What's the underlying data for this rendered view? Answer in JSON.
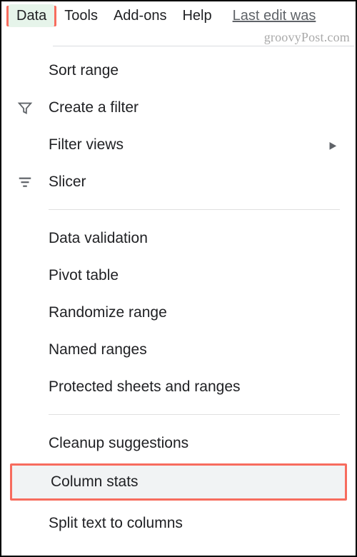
{
  "menubar": {
    "data": "Data",
    "tools": "Tools",
    "addons": "Add-ons",
    "help": "Help",
    "last_edit": "Last edit was"
  },
  "watermark": "groovyPost.com",
  "menu": {
    "sort_range": "Sort range",
    "create_filter": "Create a filter",
    "filter_views": "Filter views",
    "slicer": "Slicer",
    "data_validation": "Data validation",
    "pivot_table": "Pivot table",
    "randomize_range": "Randomize range",
    "named_ranges": "Named ranges",
    "protected_sheets": "Protected sheets and ranges",
    "cleanup_suggestions": "Cleanup suggestions",
    "column_stats": "Column stats",
    "split_text": "Split text to columns"
  }
}
